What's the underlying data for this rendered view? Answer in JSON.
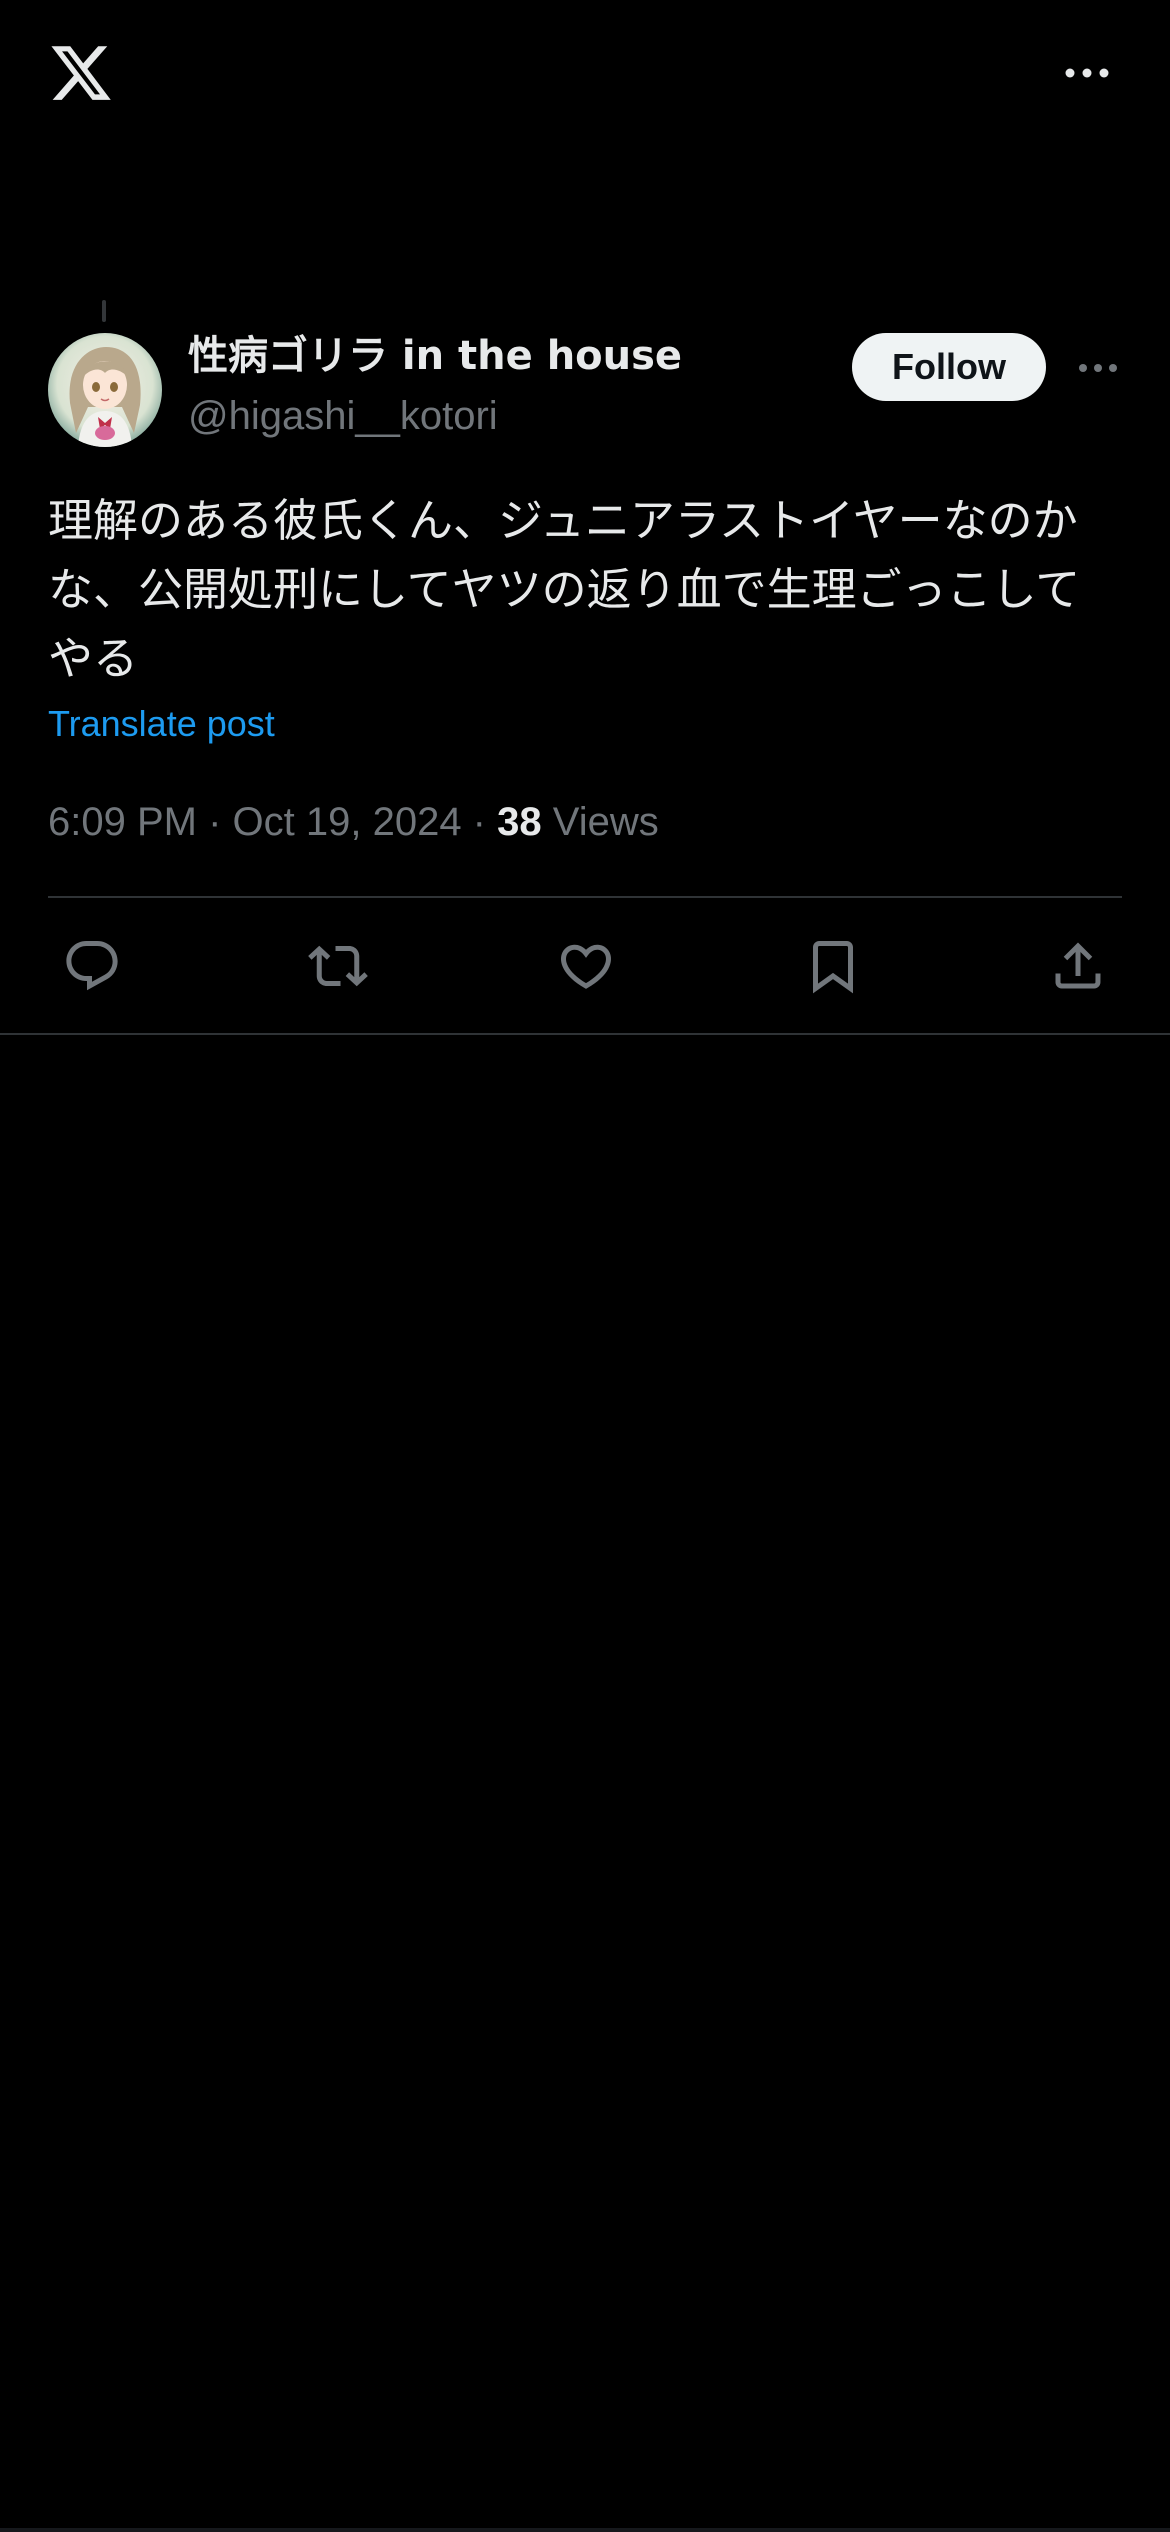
{
  "header": {
    "logo_icon": "x-logo-icon",
    "more_icon": "more-horizontal-icon"
  },
  "post": {
    "author": {
      "display_name": "性病ゴリラ in the house",
      "handle": "@higashi__kotori",
      "avatar_icon": "avatar-image"
    },
    "follow_label": "Follow",
    "more_icon": "more-horizontal-icon",
    "text": "理解のある彼氏くん、ジュニアラストイヤーなのかな、公開処刑にしてヤツの返り血で生理ごっこしてやる",
    "translate_label": "Translate post",
    "time": "6:09 PM",
    "separator": " · ",
    "date": "Oct 19, 2024",
    "views_count": "38",
    "views_label": "Views"
  },
  "actions": [
    {
      "name": "reply",
      "icon": "reply-icon"
    },
    {
      "name": "repost",
      "icon": "repost-icon"
    },
    {
      "name": "like",
      "icon": "heart-icon"
    },
    {
      "name": "bookmark",
      "icon": "bookmark-icon"
    },
    {
      "name": "share",
      "icon": "share-icon"
    }
  ],
  "colors": {
    "background": "#000000",
    "text_primary": "#e7e9ea",
    "text_secondary": "#71767b",
    "accent": "#1d9bf0",
    "divider": "#2f3336",
    "follow_bg": "#eff3f4"
  }
}
